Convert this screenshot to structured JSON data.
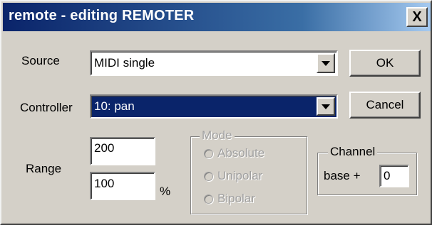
{
  "window": {
    "title": "remote - editing REMOTER",
    "close_glyph": "X"
  },
  "source": {
    "label": "Source",
    "value": "MIDI single"
  },
  "controller": {
    "label": "Controller",
    "value": "10: pan"
  },
  "range": {
    "label": "Range",
    "top_value": "200",
    "bottom_value": "100",
    "unit": "%"
  },
  "mode": {
    "legend": "Mode",
    "options": [
      "Absolute",
      "Unipolar",
      "Bipolar"
    ]
  },
  "channel": {
    "legend": "Channel",
    "base_label": "base +",
    "base_value": "0"
  },
  "buttons": {
    "ok": "OK",
    "cancel": "Cancel"
  },
  "colors": {
    "title_start": "#0a246a",
    "title_end": "#a6caf0",
    "face": "#d4d0c8",
    "selection": "#0a246a"
  }
}
